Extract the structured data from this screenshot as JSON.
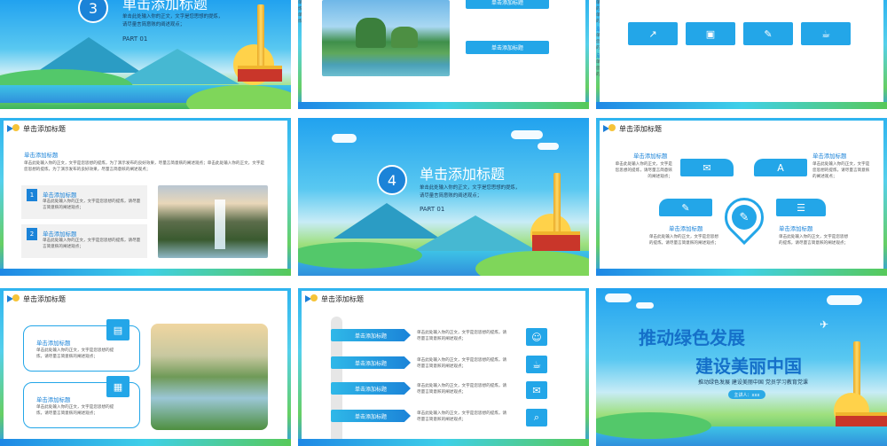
{
  "placeholder": {
    "title": "单击添加标题",
    "body": "单击此处输入你的正文，文字是您思想的提炼，请尽量言简意赅的阐述观点；",
    "body_long": "单击此处输入你的正文，文字是您思想的提炼，为了演示发布的良好效果，尽量言简意赅的阐述观点；单击此处输入你的正文，文字是您思想的提炼，为了演示发布的良好效果，尽量言简意赅的阐述观点；",
    "body_a": "单击此处输入你的正文，文字是您思想的提炼，请尽量言简意赅的阐述观点；",
    "part": "PART 01"
  },
  "slide_top_left": {
    "number": "3"
  },
  "slide_mid_left": {
    "items": [
      {
        "num": "1"
      },
      {
        "num": "2"
      }
    ]
  },
  "slide_mid_center": {
    "number": "4"
  },
  "slide_bottom_right": {
    "title_line1": "推动绿色发展",
    "title_line2": "建设美丽中国",
    "subtitle": "推动绿色发展 建设美丽中国 党员学习教育党课",
    "speaker": "主讲人：xxx"
  },
  "icons": {
    "chart": "chart-icon",
    "briefcase": "briefcase-icon",
    "pencil": "pencil-icon",
    "cup": "cup-icon",
    "document": "document-icon",
    "users": "users-icon",
    "mail": "mail-icon",
    "search": "search-icon"
  },
  "colors": {
    "accent": "#1b83d8",
    "sky": "#23a6e8",
    "green": "#57c95a"
  }
}
